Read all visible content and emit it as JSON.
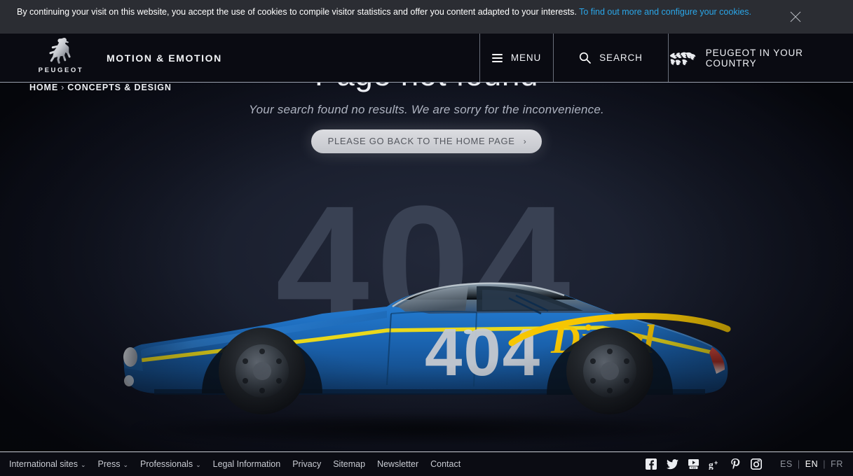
{
  "cookie_banner": {
    "text_before": "By continuing your visit on this website, you accept the use of cookies to compile visitor statistics and offer you content adapted to your interests. ",
    "link_text": "To find out more and configure your cookies.",
    "link_color": "#2ba6e8",
    "close_icon": "close-icon",
    "background": "#2b2d33"
  },
  "header": {
    "brand_word": "PEUGEOT",
    "tagline": "MOTION & EMOTION",
    "logo_icon": "peugeot-lion-icon",
    "nav": [
      {
        "label": "MENU",
        "icon": "hamburger-icon"
      },
      {
        "label": "SEARCH",
        "icon": "search-icon"
      },
      {
        "label": "PEUGEOT IN YOUR COUNTRY",
        "icon": "world-map-icon"
      }
    ]
  },
  "breadcrumb": {
    "items": [
      "HOME",
      "CONCEPTS & DESIGN"
    ],
    "separator": "›"
  },
  "main": {
    "title": "Page not found",
    "subtitle": "Your search found no results. We are sorry for the inconvenience.",
    "button_label": "PLEASE GO BACK TO THE HOME PAGE",
    "button_chevron": "›",
    "ghost_number": "404",
    "hero_image": {
      "name": "peugeot-404-diesel-record-car",
      "door_number": "404",
      "script_text": "Diesel",
      "body_color": "#1f6fc4",
      "stripe_color": "#e8d418",
      "number_color": "#c9ccd1",
      "script_color": "#f5c400"
    }
  },
  "footer": {
    "links": [
      {
        "label": "International sites",
        "has_caret": true
      },
      {
        "label": "Press",
        "has_caret": true
      },
      {
        "label": "Professionals",
        "has_caret": true
      },
      {
        "label": "Legal Information",
        "has_caret": false
      },
      {
        "label": "Privacy",
        "has_caret": false
      },
      {
        "label": "Sitemap",
        "has_caret": false
      },
      {
        "label": "Newsletter",
        "has_caret": false
      },
      {
        "label": "Contact",
        "has_caret": false
      }
    ],
    "caret_glyph": "⌄",
    "social": [
      {
        "name": "facebook-icon",
        "glyph": "f"
      },
      {
        "name": "twitter-icon",
        "glyph": "t"
      },
      {
        "name": "youtube-icon",
        "glyph": "y"
      },
      {
        "name": "googleplus-icon",
        "glyph": "g"
      },
      {
        "name": "pinterest-icon",
        "glyph": "p"
      },
      {
        "name": "instagram-icon",
        "glyph": "i"
      }
    ],
    "languages": [
      {
        "code": "ES",
        "active": false
      },
      {
        "code": "EN",
        "active": true
      },
      {
        "code": "FR",
        "active": false
      }
    ],
    "lang_separator": "|"
  }
}
